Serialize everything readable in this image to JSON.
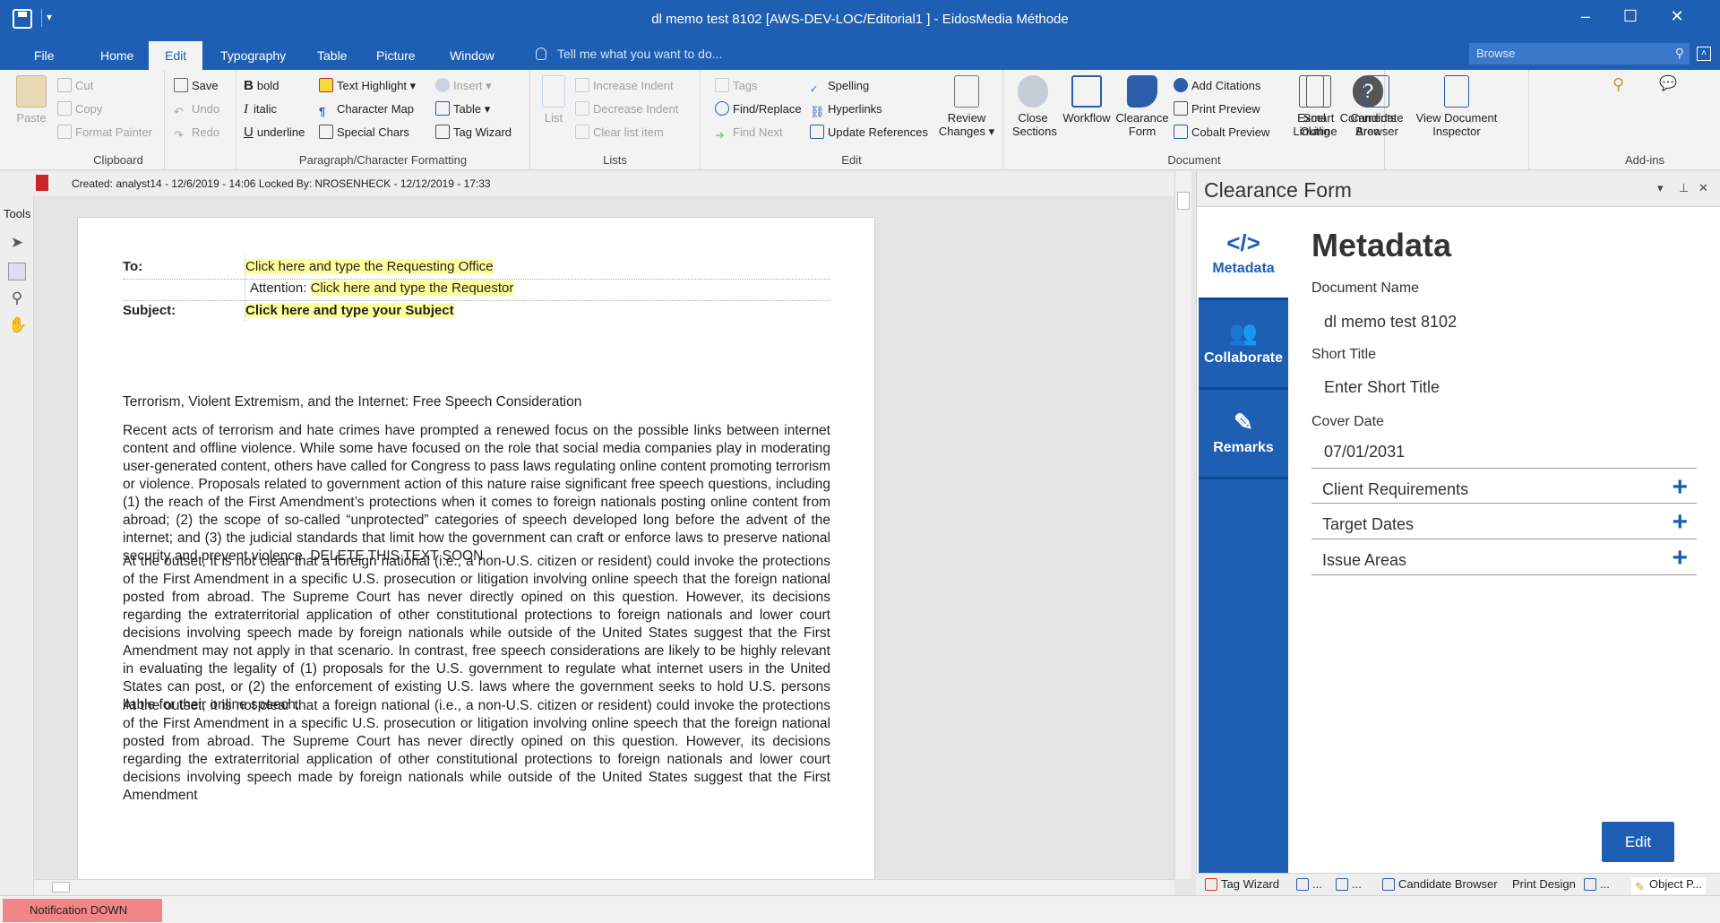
{
  "window": {
    "title": "dl memo test 8102  [AWS-DEV-LOC/Editorial1 ] - EidosMedia Méthode",
    "minimize": "–",
    "maximize": "☐",
    "close": "✕",
    "quick_access_more": "▾"
  },
  "menu_tabs": [
    "File",
    "Home",
    "Edit",
    "Typography",
    "Table",
    "Picture",
    "Window"
  ],
  "active_tab": "Edit",
  "tell_me": "Tell me what you want to do...",
  "browse_placeholder": "Browse",
  "ribbon": {
    "clipboard": {
      "label": "Clipboard",
      "paste": "Paste",
      "cut": "Cut",
      "copy": "Copy",
      "format_painter": "Format Painter",
      "save": "Save",
      "undo": "Undo",
      "redo": "Redo"
    },
    "formatting": {
      "label": "Paragraph/Character Formatting",
      "bold": "bold",
      "italic": "italic",
      "underline": "underline",
      "text_highlight": "Text Highlight",
      "character_map": "Character Map",
      "special_chars": "Special Chars",
      "insert": "Insert",
      "table": "Table",
      "tag_wizard": "Tag Wizard"
    },
    "lists": {
      "label": "Lists",
      "list": "List",
      "increase_indent": "Increase Indent",
      "decrease_indent": "Decrease Indent",
      "clear_list_item": "Clear list item"
    },
    "edit": {
      "label": "Edit",
      "tags": "Tags",
      "find_replace": "Find/Replace",
      "find_next": "Find Next",
      "spelling": "Spelling",
      "hyperlinks": "Hyperlinks",
      "update_references": "Update References",
      "review_changes_1": "Review",
      "review_changes_2": "Changes"
    },
    "document": {
      "label": "Document",
      "close_sections_1": "Close",
      "close_sections_2": "Sections",
      "workflow": "Workflow",
      "clearance_form_1": "Clearance",
      "clearance_form_2": "Form",
      "add_citations": "Add Citations",
      "print_preview": "Print Preview",
      "cobalt_preview": "Cobalt Preview",
      "excel_1": "Excel",
      "excel_2": "Linking",
      "comments_1": "Comments",
      "comments_2": "Area",
      "smart_1": "Smart",
      "smart_2": "Outline",
      "candidate_1": "Candidate",
      "candidate_2": "Browser",
      "view_doc_1": "View Document",
      "view_doc_2": "Inspector"
    },
    "addins": {
      "label": "Add-ins"
    }
  },
  "doc_info": "Created: analyst14 - 12/6/2019 - 14:06    Locked By: NROSENHECK - 12/12/2019 - 17:33",
  "tools_label": "Tools",
  "memo": {
    "to_label": "To:",
    "to_value": "Click here and type the Requesting Office",
    "attention_label": "Attention:",
    "attention_value": "Click here and type the Requestor",
    "subject_label": "Subject:",
    "subject_value": "Click here and type your Subject"
  },
  "document": {
    "heading": "Terrorism, Violent Extremism, and the Internet: Free Speech Consideration",
    "p1": "Recent acts of terrorism and hate crimes have prompted a renewed focus on the possible links between internet content and offline violence. While some have focused on the role that social media companies play in moderating user-generated content, others have called for Congress to pass laws regulating online content promoting terrorism or violence. Proposals related to government action of this nature raise significant free speech questions, including (1) the reach of the First Amendment’s protections when it comes to foreign nationals posting online content from abroad; (2) the scope of so-called “unprotected” categories of speech developed long before the advent of the internet; and (3) the judicial standards that limit how the government can craft or enforce laws to preserve national security and prevent violence. DELETE THIS TEXT SOON",
    "p2": "At the outset, it is not clear that a foreign national (i.e., a non-U.S. citizen or resident) could invoke the protections of the First Amendment in a specific U.S. prosecution or litigation involving online speech that the foreign national posted from abroad. The Supreme Court has never directly opined on this question. However, its decisions regarding the extraterritorial application of other constitutional protections to foreign nationals and lower court decisions involving speech made by foreign nationals while outside of the United States suggest that the First Amendment may not apply in that scenario. In contrast, free speech considerations are likely to be highly relevant in evaluating the legality of (1) proposals for the U.S. government to regulate what internet users in the United States can post, or (2) the enforcement of existing U.S. laws where the government seeks to hold U.S. persons liable for their online speech.",
    "p3": "At the outset, it is not clear that a foreign national (i.e., a non-U.S. citizen or resident) could invoke the protections of the First Amendment in a specific U.S. prosecution or litigation involving online speech that the foreign national posted from abroad. The Supreme Court has never directly opined on this question. However, its decisions regarding the extraterritorial application of other constitutional protections to foreign nationals and lower court decisions involving speech made by foreign nationals while outside of the United States suggest that the First Amendment"
  },
  "panel": {
    "title": "Clearance Form",
    "nav": [
      {
        "label": "Metadata",
        "icon": "code-icon"
      },
      {
        "label": "Collaborate",
        "icon": "users-icon"
      },
      {
        "label": "Remarks",
        "icon": "edit-icon"
      }
    ],
    "heading": "Metadata",
    "fields": {
      "doc_name_label": "Document Name",
      "doc_name_value": "dl memo test 8102",
      "short_title_label": "Short Title",
      "short_title_placeholder": "Enter Short Title",
      "cover_date_label": "Cover Date",
      "cover_date_value": "07/01/2031"
    },
    "sections": [
      "Client Requirements",
      "Target Dates",
      "Issue Areas"
    ],
    "edit_button": "Edit"
  },
  "panel_tabs": [
    "Tag Wizard",
    "...",
    "...",
    "Candidate Browser",
    "Print Design",
    "...",
    "Object P..."
  ],
  "status": {
    "notification": "Notification DOWN"
  },
  "colors": {
    "accent": "#1e5fb4",
    "highlight": "#ffff99",
    "notification": "#f28686"
  }
}
